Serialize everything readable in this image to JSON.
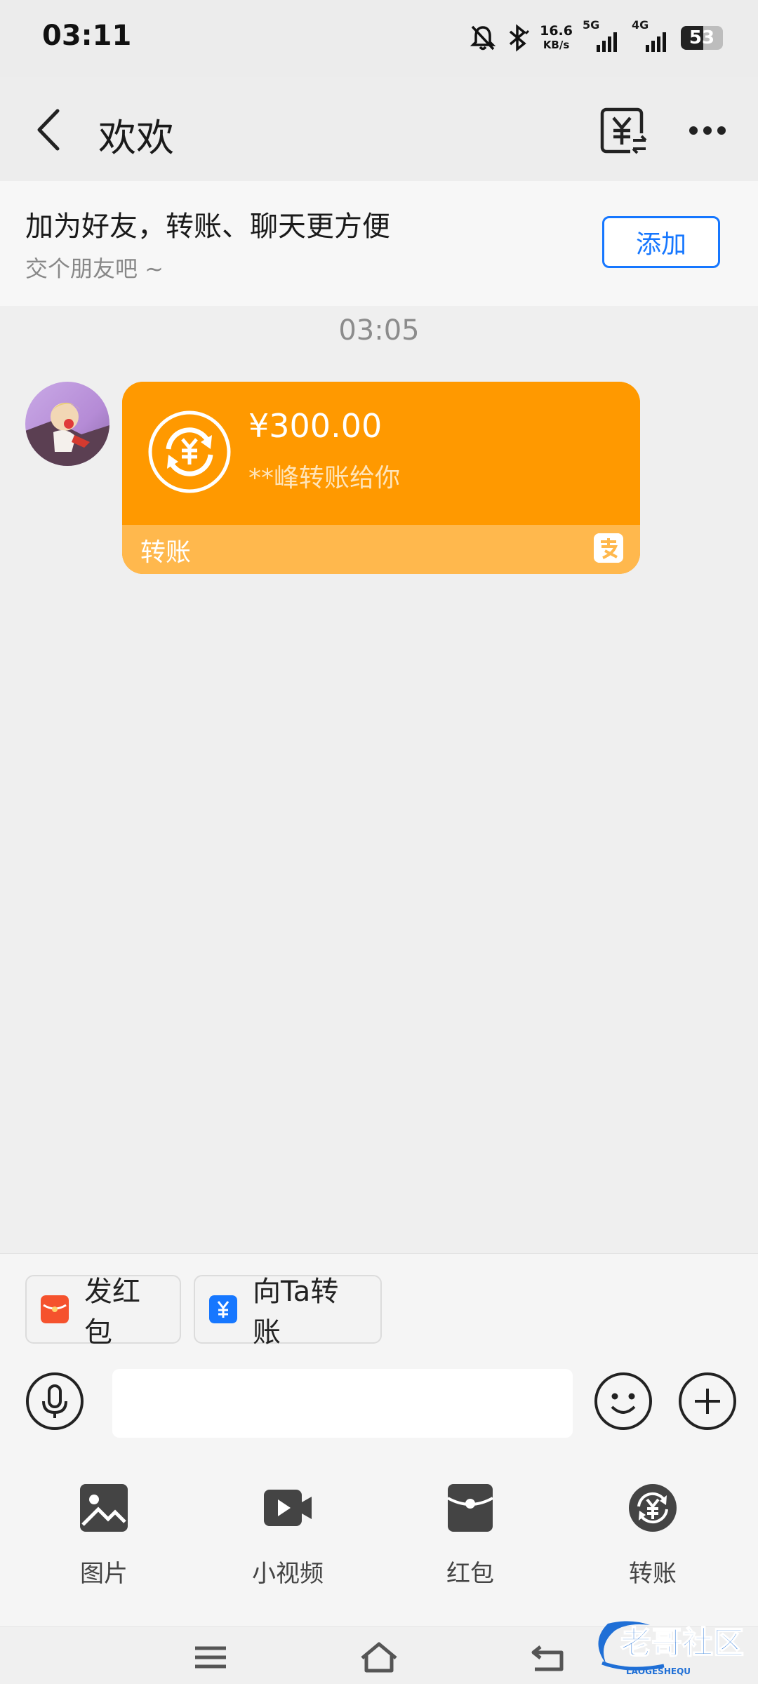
{
  "status_bar": {
    "time": "03:11",
    "net_speed_value": "16.6",
    "net_speed_unit": "KB/s",
    "sim1_label": "5G",
    "sim2_label": "4G",
    "battery_level": "53"
  },
  "header": {
    "title": "欢欢"
  },
  "banner": {
    "title": "加为好友，转账、聊天更方便",
    "subtitle": "交个朋友吧 ~",
    "add_button": "添加"
  },
  "chat": {
    "timestamp": "03:05",
    "messages": [
      {
        "type": "transfer",
        "amount": "¥300.00",
        "description": "**峰转账给你",
        "label": "转账"
      }
    ]
  },
  "quick_actions": [
    {
      "label": "发红包",
      "icon": "red-envelope-icon"
    },
    {
      "label": "向Ta转账",
      "icon": "transfer-yuan-icon"
    }
  ],
  "input": {
    "value": "",
    "placeholder": ""
  },
  "tools": [
    {
      "label": "图片",
      "icon": "image-icon"
    },
    {
      "label": "小视频",
      "icon": "video-icon"
    },
    {
      "label": "红包",
      "icon": "red-packet-icon"
    },
    {
      "label": "转账",
      "icon": "transfer-icon"
    }
  ],
  "watermark": {
    "text": "老哥社区",
    "subtext": "LAOGESHEQU"
  },
  "colors": {
    "card_orange": "#ff9900",
    "card_footer": "#ffb84d",
    "accent_blue": "#1677ff",
    "red_envelope": "#f5522d"
  }
}
